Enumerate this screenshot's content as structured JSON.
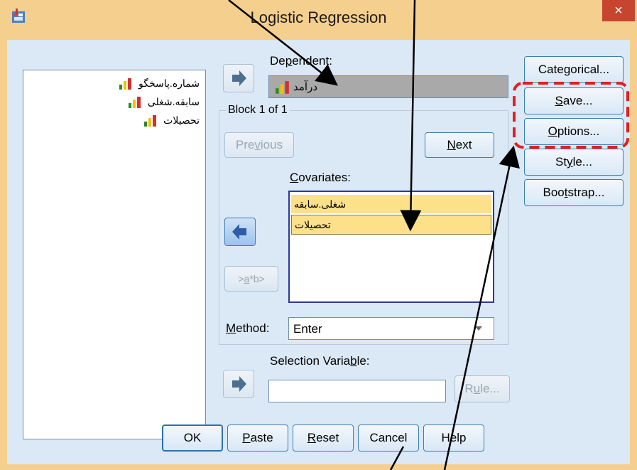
{
  "window": {
    "title": "Logistic Regression",
    "close_glyph": "×",
    "icon": "spss-dialog-icon"
  },
  "variables": [
    {
      "label": "شماره.پاسخگو",
      "icon": "scale-variable-icon"
    },
    {
      "label": "سابقه.شغلی",
      "icon": "scale-variable-icon"
    },
    {
      "label": "تحصیلات",
      "icon": "scale-variable-icon"
    }
  ],
  "dependent": {
    "label_pre": "De",
    "label_u": "p",
    "label_post": "endent:",
    "value": "درآمد"
  },
  "block": {
    "label": "Block 1 of 1",
    "previous": "Previous",
    "previous_pre": "Pre",
    "previous_u": "v",
    "previous_post": "ious",
    "next_u": "N",
    "next_post": "ext"
  },
  "covariates": {
    "label_u": "C",
    "label_post": "ovariates:",
    "items": [
      "شغلی.سابقه",
      "تحصیلات"
    ]
  },
  "interaction_button": {
    "pre": ">",
    "u": "a",
    "post": "*b>"
  },
  "method": {
    "label_u": "M",
    "label_post": "ethod:",
    "value": "Enter"
  },
  "selection": {
    "label_pre": "Selection Varia",
    "label_u": "b",
    "label_post": "le:",
    "value": "",
    "rule_pre": "R",
    "rule_u": "u",
    "rule_post": "le..."
  },
  "side_buttons": {
    "categorical": {
      "pre": "Cate",
      "u": "g",
      "post": "orical..."
    },
    "save": {
      "pre": "",
      "u": "S",
      "post": "ave..."
    },
    "options": {
      "pre": "",
      "u": "O",
      "post": "ptions..."
    },
    "style": {
      "pre": "St",
      "u": "y",
      "post": "le..."
    },
    "bootstrap": {
      "pre": "Boo",
      "u": "t",
      "post": "strap..."
    }
  },
  "bottom_buttons": {
    "ok": "OK",
    "paste": {
      "u": "P",
      "post": "aste"
    },
    "reset": {
      "u": "R",
      "post": "eset"
    },
    "cancel": "Cancel",
    "help": "Help"
  },
  "colors": {
    "frame": "#f5cf8d",
    "client": "#dbe8f6",
    "highlight": "#fce08a",
    "annotation_red": "#e02020"
  }
}
